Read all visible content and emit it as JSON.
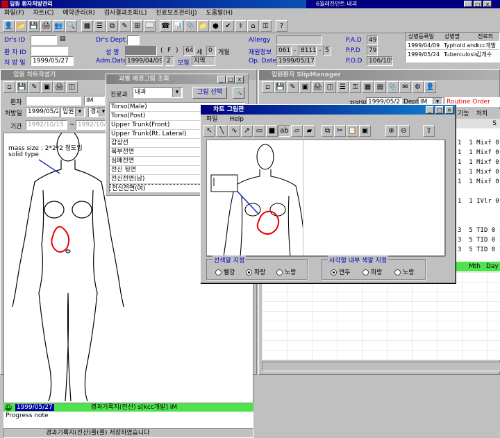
{
  "main_title": "입원 환자처방관리",
  "task_title": "6월레진던트 내괴",
  "menu": [
    "화일(F)",
    "차트(C)",
    "예약관리(R)",
    "검사결과조회(L)",
    "진료보조관리(J)",
    "도움말(H)"
  ],
  "patient": {
    "drs_id_label": "Dr's ID",
    "drs_dept_label": "Dr's Dept.",
    "allergy_label": "Allergy",
    "pad_label": "P.A.D",
    "pad_value": "49",
    "patient_id_label": "환 자 ID",
    "name_label": "성    명",
    "sex": "F",
    "age": "64",
    "age_unit": "세",
    "months": "0",
    "months_unit": "개월",
    "readmit_label": "재원정보",
    "readmit_1": "061",
    "readmit_2": "8111",
    "readmit_3": "5",
    "ppd_label": "P.P.D",
    "ppd_value": "79",
    "rx_date_label": "처 방 일",
    "rx_date": "1999/05/27",
    "adm_date_label": "Adm.Date",
    "adm_date": "1999/04/09",
    "adm_no": "2",
    "insurance_label": "보험",
    "insurance": "지역",
    "opdate_label": "Op. Date",
    "op_date": "1999/05/17",
    "pod_label": "P.O.D",
    "pod_value": "106/105/"
  },
  "disease": {
    "headers": [
      "상병등록일",
      "상병명",
      "진료의"
    ],
    "rows": [
      [
        "1999/04/09",
        "Typhoid and",
        "kcc개발"
      ],
      [
        "1999/05/24",
        "Tuberculosis",
        "김개수"
      ]
    ]
  },
  "chart_win": {
    "title": "입원 차트작성기",
    "patient_label": "환자",
    "dept_value": "IM",
    "rx_label": "처방일",
    "rx_date": "1999/05/27",
    "inout": "입원",
    "course": "경과",
    "period_label": "기간",
    "period_from": "1992/10/15",
    "period_to": "1992/10/15",
    "note_1": "mass size : 2*2*2 정도임",
    "note_2": "solid type",
    "status_date": "1999/05/27",
    "status_text": "경과기록지(전산) s[kcc개발] IM",
    "progress": "Progress note",
    "status_msg": "경과기록지(전산)를(를) 저장하였습니다"
  },
  "body_win": {
    "title": "과별 배경그림 조회",
    "dept_label": "진료과",
    "dept_value": "내과",
    "select_btn": "그림 선택",
    "items": [
      "Torso(Male)",
      "Torso(Post)",
      "Upper Trunk(Front)",
      "Upper Trunk(Rt. Lateral)",
      "갑상선",
      "복부전면",
      "심폐전면",
      "전신 뒷면",
      "전신전면(남)",
      "전신전면(여)"
    ]
  },
  "slip_win": {
    "title": "입원환자 SlipManager",
    "rx_label": "처방일",
    "rx_date": "1999/05/27",
    "dept_label": "Dept",
    "dept_value": "IM",
    "routine": "Routine Order",
    "col_func": "기능",
    "col_proc": "처치",
    "col_s": "S",
    "col_mth": "Mth",
    "col_day": "Day",
    "rows": [
      [
        "1",
        "1",
        "Mixf",
        "0 5"
      ],
      [
        "1",
        "1",
        "Mixf",
        "0 5"
      ],
      [
        "1",
        "1",
        "Mixf",
        "0 5"
      ],
      [
        "1",
        "1",
        "Mixf",
        "0 5"
      ],
      [
        "1",
        "1",
        "Mixf",
        "0 5"
      ],
      [
        "1",
        "1",
        "IVlr",
        "0 5"
      ],
      [
        "3",
        "5",
        "TID",
        "0 1"
      ],
      [
        "3",
        "5",
        "TID",
        "0 1"
      ],
      [
        "3",
        "5",
        "TID",
        "0 1"
      ]
    ]
  },
  "drawer": {
    "title": "차트 그림판",
    "menu": [
      "파일",
      "Help"
    ],
    "line_label": "선색깔 지정",
    "line_opts": [
      "빨강",
      "파랑",
      "노랑"
    ],
    "line_sel": 1,
    "fill_label": "사각형 내부 색깔 지정",
    "fill_opts": [
      "연두",
      "파랑",
      "노랑"
    ],
    "fill_sel": 0
  }
}
